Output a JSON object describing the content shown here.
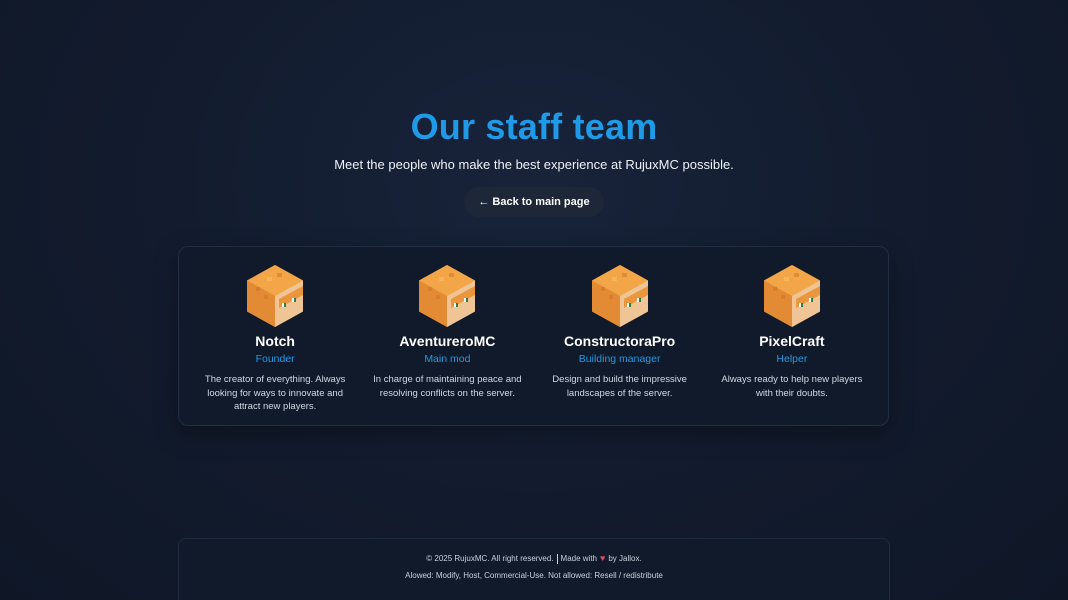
{
  "hero": {
    "title": "Our staff team",
    "subtitle": "Meet the people who make the best experience at RujuxMC possible.",
    "back_button": "← Back to main page"
  },
  "staff": [
    {
      "name": "Notch",
      "role": "Founder",
      "description": "The creator of everything. Always looking for ways to innovate and attract new players.",
      "avatar_icon": "minecraft-skin-head-icon"
    },
    {
      "name": "AventureroMC",
      "role": "Main mod",
      "description": "In charge of maintaining peace and resolving conflicts on the server.",
      "avatar_icon": "minecraft-skin-head-icon"
    },
    {
      "name": "ConstructoraPro",
      "role": "Building manager",
      "description": "Design and build the impressive landscapes of the server.",
      "avatar_icon": "minecraft-skin-head-icon"
    },
    {
      "name": "PixelCraft",
      "role": "Helper",
      "description": "Always ready to help new players with their doubts.",
      "avatar_icon": "minecraft-skin-head-icon"
    }
  ],
  "footer": {
    "copyright": "© 2025 RujuxMC. All right reserved.",
    "made_with": "Made with",
    "heart": "♥",
    "by": "by Jallox.",
    "license": "Alowed: Modify, Host, Commercial-Use. Not allowed: Resell / redistribute"
  },
  "colors": {
    "accent": "#1f9ae6",
    "background": "#121b2d",
    "card": "#111a2b",
    "heart": "#e5485a"
  }
}
